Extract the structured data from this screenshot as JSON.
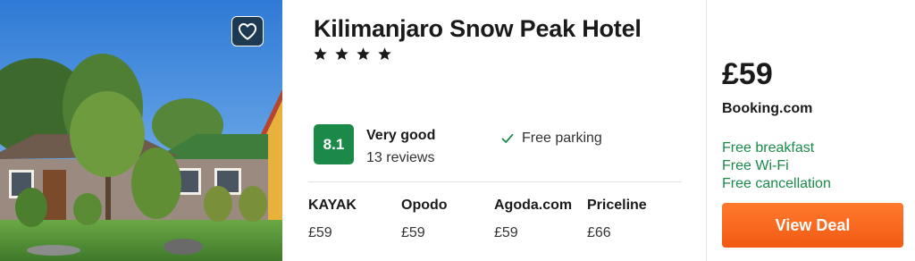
{
  "hotel": {
    "name": "Kilimanjaro Snow Peak Hotel",
    "star_count": 4,
    "photo_icon": "hotel-photo"
  },
  "favorite": {
    "icon": "heart-icon"
  },
  "rating": {
    "score": "8.1",
    "label": "Very good",
    "reviews": "13 reviews",
    "color": "#1b8a49"
  },
  "amenity": {
    "icon": "check-icon",
    "label": "Free parking"
  },
  "providers": [
    {
      "name": "KAYAK",
      "price": "£59"
    },
    {
      "name": "Opodo",
      "price": "£59"
    },
    {
      "name": "Agoda.com",
      "price": "£59"
    },
    {
      "name": "Priceline",
      "price": "£66"
    }
  ],
  "deal": {
    "price": "£59",
    "source": "Booking.com",
    "perks": [
      "Free breakfast",
      "Free Wi-Fi",
      "Free cancellation"
    ],
    "button_label": "View Deal",
    "button_color": "#f25a12"
  }
}
